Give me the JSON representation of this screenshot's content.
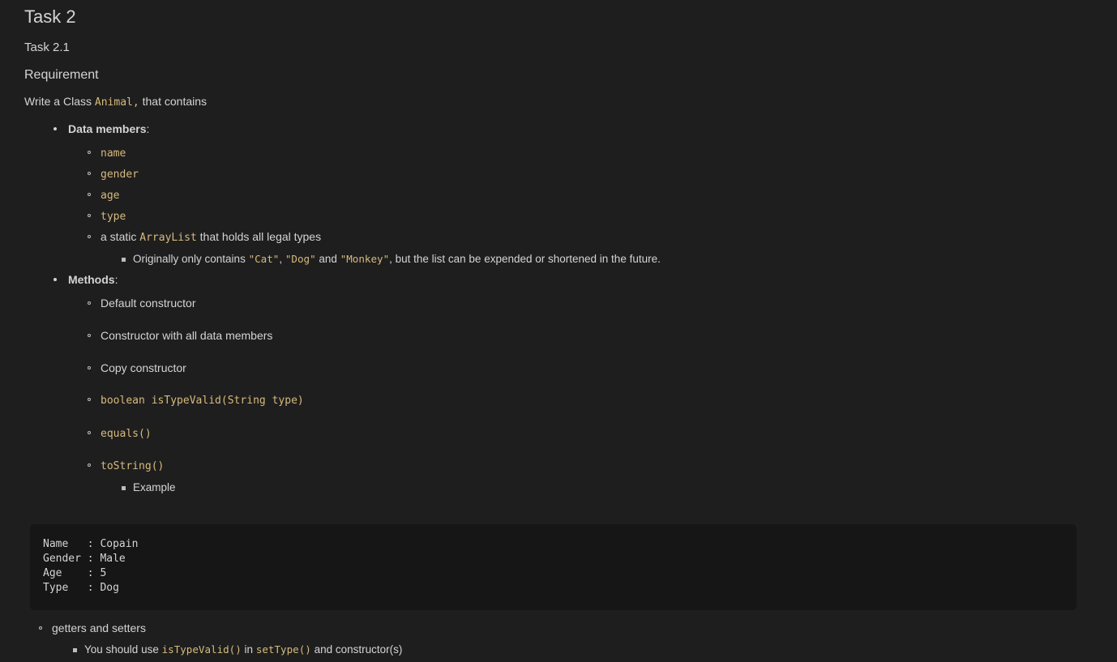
{
  "document": {
    "title": "Task 2",
    "subtitle": "Task 2.1",
    "section_heading": "Requirement",
    "intro": {
      "before": "Write a Class ",
      "code": "Animal,",
      "after": " that contains"
    },
    "sections": [
      {
        "label": "Data members",
        "label_suffix": ":",
        "items": [
          {
            "kind": "code",
            "text": "name"
          },
          {
            "kind": "code",
            "text": "gender"
          },
          {
            "kind": "code",
            "text": "age"
          },
          {
            "kind": "code",
            "text": "type"
          },
          {
            "kind": "mixed",
            "parts": [
              {
                "type": "text",
                "text": "a static "
              },
              {
                "type": "code",
                "text": "ArrayList"
              },
              {
                "type": "text",
                "text": " that holds all legal types"
              }
            ],
            "children": [
              {
                "parts": [
                  {
                    "type": "text",
                    "text": "Originally only contains "
                  },
                  {
                    "type": "code",
                    "text": "\"Cat\""
                  },
                  {
                    "type": "text",
                    "text": ", "
                  },
                  {
                    "type": "code",
                    "text": "\"Dog\""
                  },
                  {
                    "type": "text",
                    "text": " and "
                  },
                  {
                    "type": "code",
                    "text": "\"Monkey\""
                  },
                  {
                    "type": "text",
                    "text": ", but the list can be expended or shortened in the future."
                  }
                ]
              }
            ]
          }
        ]
      },
      {
        "label": "Methods",
        "label_suffix": ":",
        "items": [
          {
            "kind": "text",
            "text": "Default constructor"
          },
          {
            "kind": "text",
            "text": "Constructor with all data members"
          },
          {
            "kind": "text",
            "text": "Copy constructor"
          },
          {
            "kind": "code",
            "text": "boolean isTypeValid(String type)"
          },
          {
            "kind": "code",
            "text": "equals()"
          },
          {
            "kind": "code",
            "text": "toString()",
            "children": [
              {
                "parts": [
                  {
                    "type": "text",
                    "text": "Example"
                  }
                ]
              }
            ]
          }
        ]
      }
    ],
    "code_block": {
      "lines": [
        "Name   : Copain",
        "Gender : Male",
        "Age    : 5",
        "Type   : Dog"
      ]
    },
    "tail": {
      "item": "getters and setters",
      "child_parts": [
        {
          "type": "text",
          "text": "You should use "
        },
        {
          "type": "code",
          "text": "isTypeValid()"
        },
        {
          "type": "text",
          "text": " in "
        },
        {
          "type": "code",
          "text": "setType()"
        },
        {
          "type": "text",
          "text": " and constructor(s)"
        }
      ]
    }
  },
  "theme": {
    "background": "#1e1e1e",
    "text": "#d4d4d4",
    "inline_code": "#d7ba7d",
    "code_block_background": "#161616"
  }
}
